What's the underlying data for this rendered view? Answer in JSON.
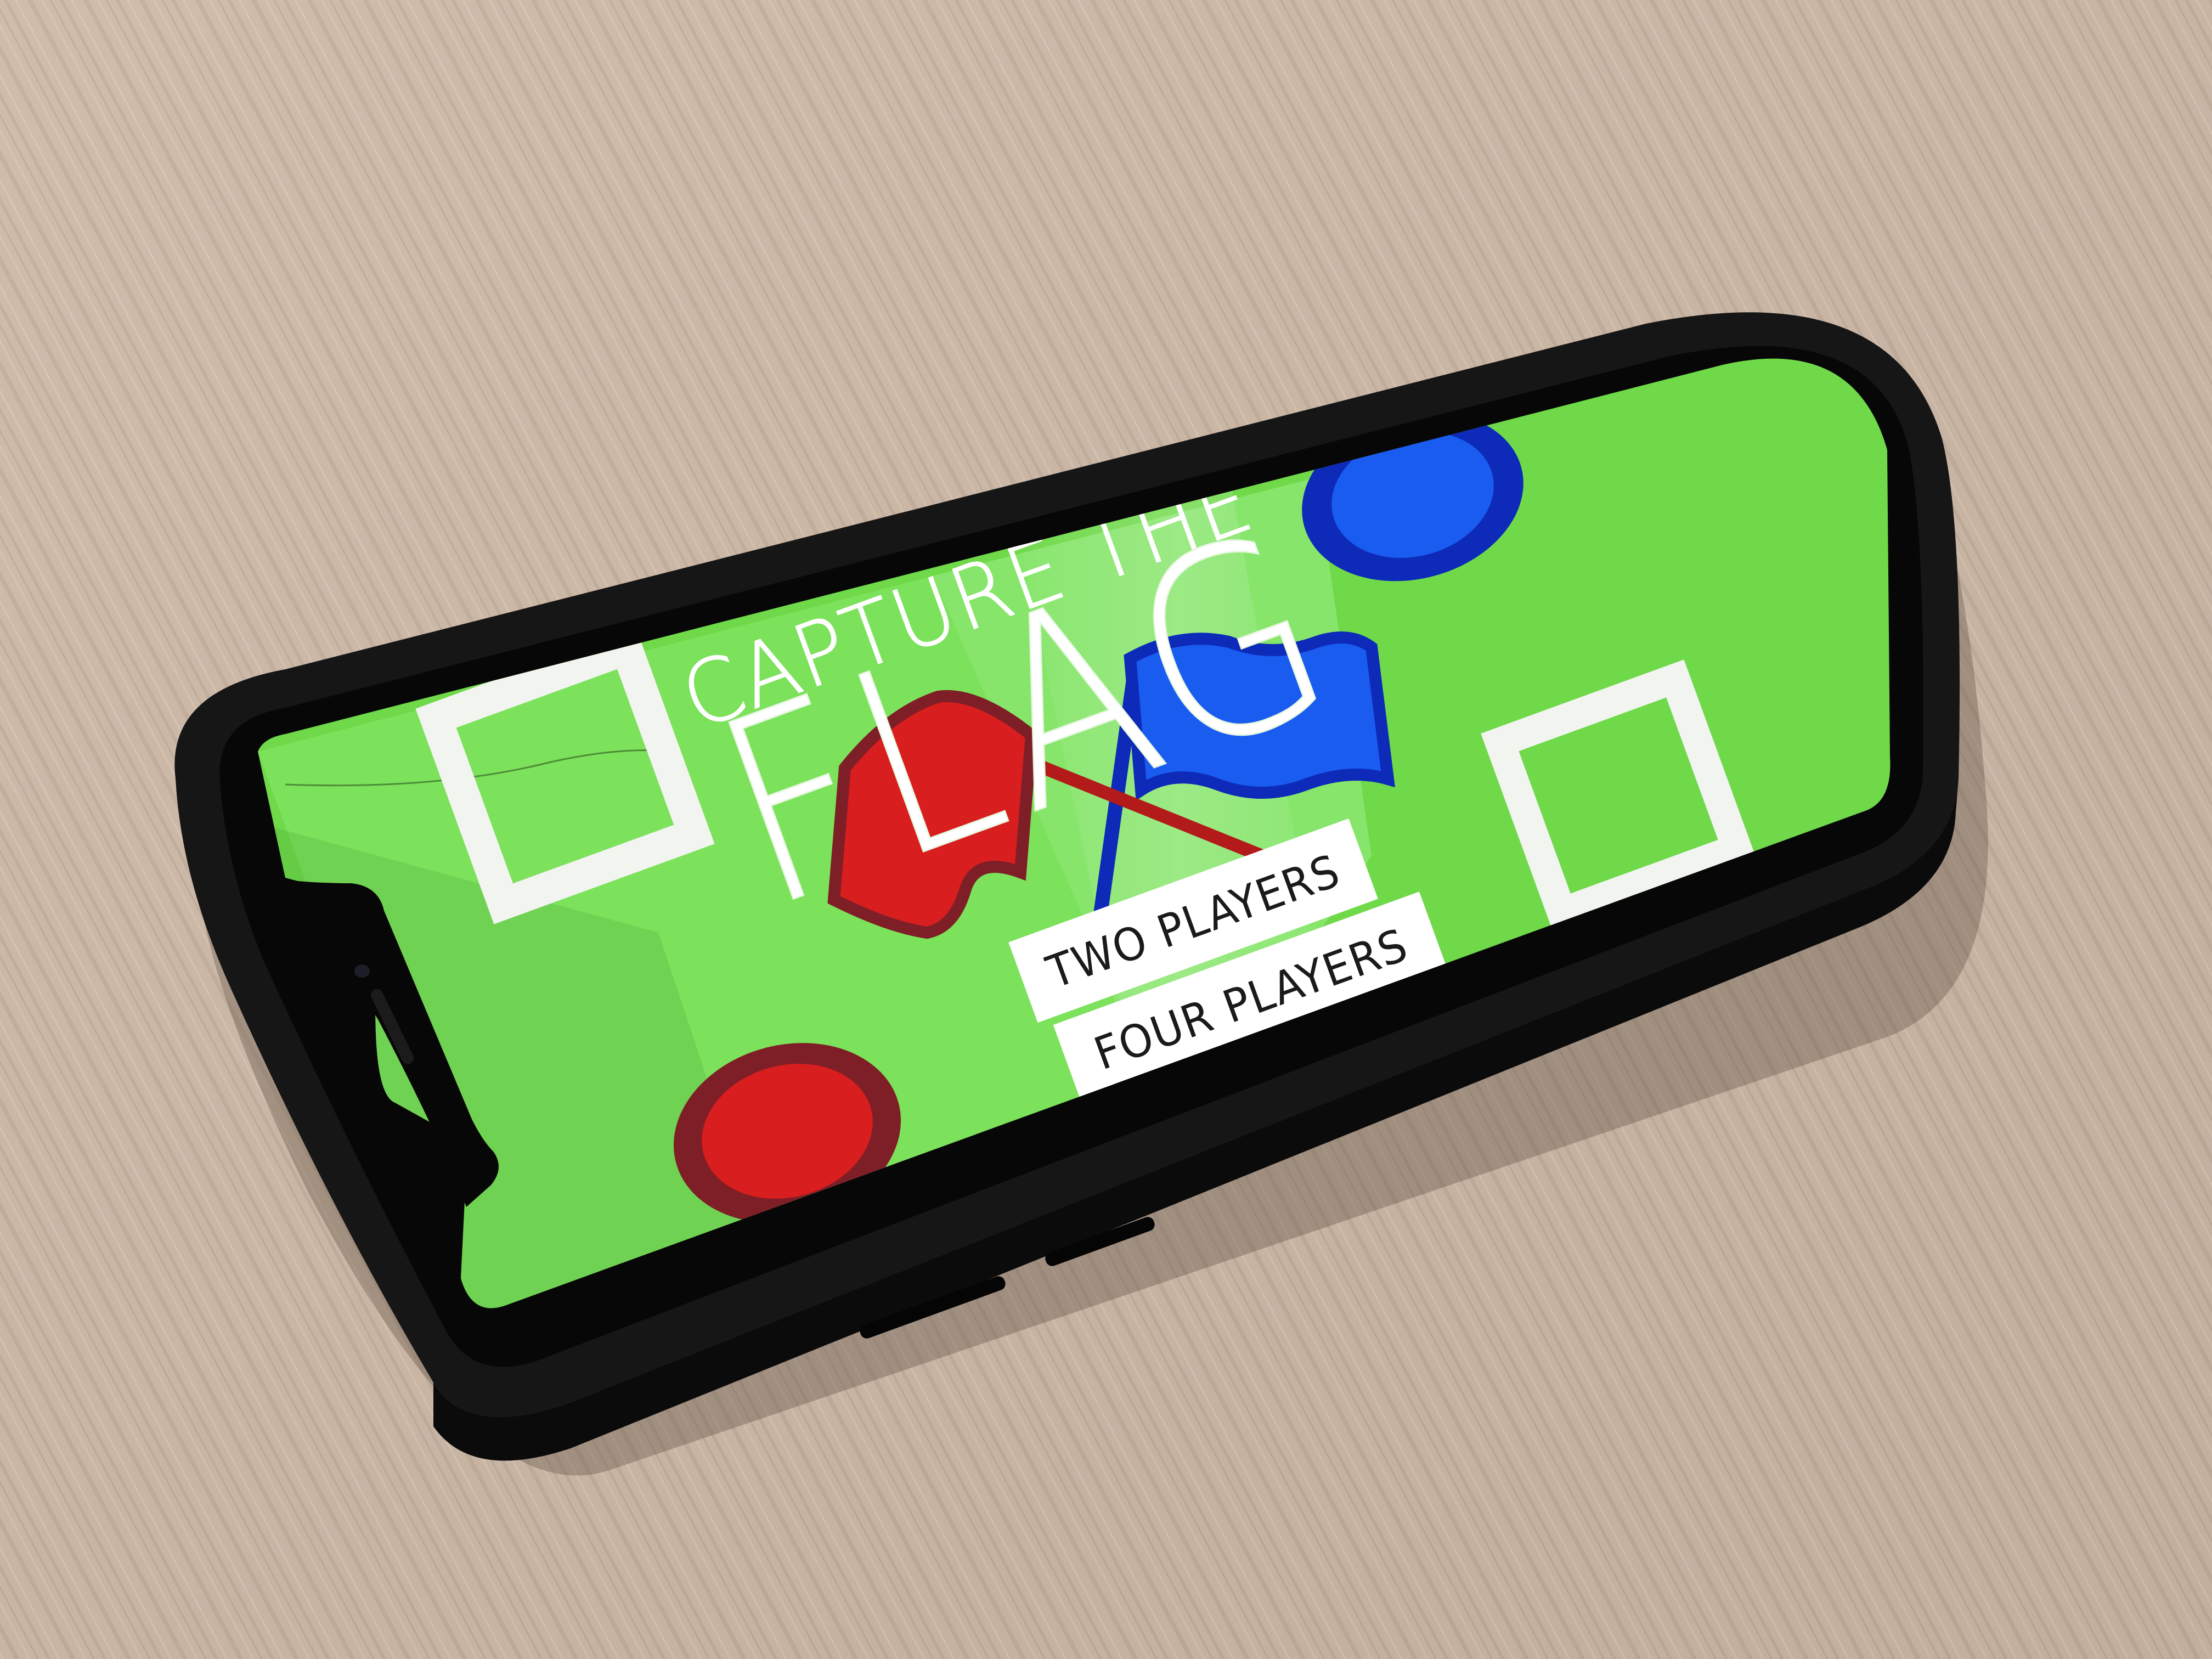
{
  "game": {
    "title_top": "CAPTURE THE",
    "title_main": "FLAG",
    "menu": {
      "two_players_label": "TWO PLAYERS",
      "four_players_label": "FOUR PLAYERS"
    }
  },
  "colors": {
    "field": "#6fd94a",
    "field_light": "#8ff07a",
    "team_red": "#d81e1e",
    "team_red_dark": "#7e1e26",
    "team_blue": "#1a5cf0",
    "team_blue_dark": "#0d2bb8",
    "base_outline": "#ffffff",
    "phone_bezel": "#111111",
    "desk": "#cdb8a6"
  }
}
